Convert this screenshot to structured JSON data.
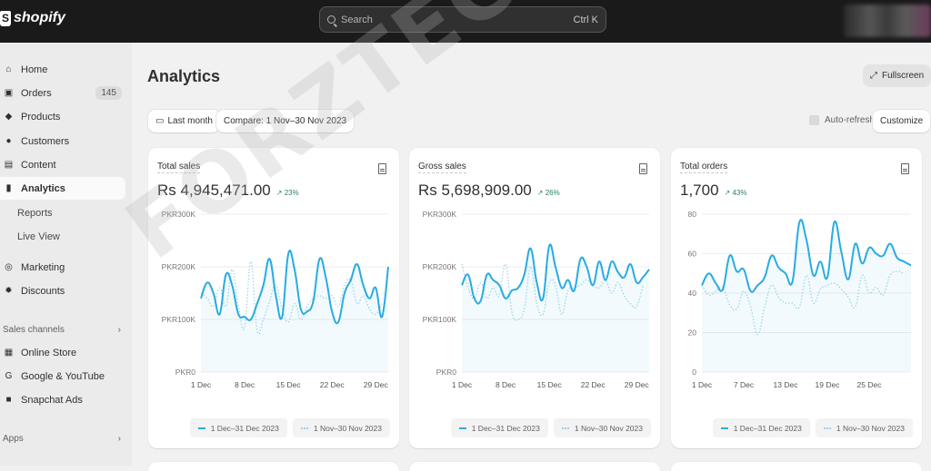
{
  "topbar": {
    "brand": "shopify",
    "search_placeholder": "Search",
    "search_shortcut": "Ctrl K"
  },
  "sidebar": {
    "items": [
      {
        "label": "Home",
        "icon": "home-icon"
      },
      {
        "label": "Orders",
        "icon": "inbox-icon",
        "badge": "145"
      },
      {
        "label": "Products",
        "icon": "tag-icon"
      },
      {
        "label": "Customers",
        "icon": "person-icon"
      },
      {
        "label": "Content",
        "icon": "image-icon"
      },
      {
        "label": "Analytics",
        "icon": "bar-chart-icon",
        "active": true
      },
      {
        "label": "Reports",
        "sub": true
      },
      {
        "label": "Live View",
        "sub": true
      },
      {
        "label": "Marketing",
        "icon": "target-icon"
      },
      {
        "label": "Discounts",
        "icon": "discount-icon"
      }
    ],
    "sales_channels_label": "Sales channels",
    "channels": [
      {
        "label": "Online Store",
        "icon": "store-icon"
      },
      {
        "label": "Google & YouTube",
        "icon": "google-icon"
      },
      {
        "label": "Snapchat Ads",
        "icon": "snapchat-icon"
      }
    ],
    "apps_label": "Apps"
  },
  "main": {
    "title": "Analytics",
    "date_button": "Last month",
    "compare_button": "Compare: 1 Nov–30 Nov 2023",
    "fullscreen_button": "Fullscreen",
    "auto_refresh_label": "Auto-refresh",
    "customize_button": "Customize"
  },
  "watermark": "FORZTECH MEDIA",
  "colors": {
    "current_series": "#29abe2",
    "previous_series": "#9dd3e8",
    "delta_positive": "#29845a"
  },
  "chart_data": [
    {
      "type": "line",
      "title": "Total sales",
      "value": "Rs 4,945,471.00",
      "delta": "23%",
      "y_ticks": [
        "PKR300K",
        "PKR200K",
        "PKR100K",
        "PKR0"
      ],
      "ylim": [
        0,
        300000
      ],
      "x_ticks": [
        "1 Dec",
        "8 Dec",
        "15 Dec",
        "22 Dec",
        "29 Dec"
      ],
      "x_tick_days": [
        1,
        8,
        15,
        22,
        29
      ],
      "days": 31,
      "legend": [
        "1 Dec–31 Dec 2023",
        "1 Nov–30 Nov 2023"
      ],
      "series": [
        {
          "name": "1 Dec–31 Dec 2023",
          "values": [
            140000,
            170000,
            150000,
            110000,
            185000,
            165000,
            110000,
            105000,
            100000,
            130000,
            165000,
            215000,
            145000,
            105000,
            225000,
            195000,
            120000,
            115000,
            135000,
            215000,
            180000,
            115000,
            95000,
            150000,
            175000,
            205000,
            165000,
            140000,
            160000,
            105000,
            200000
          ]
        },
        {
          "name": "1 Nov–30 Nov 2023",
          "values": [
            150000,
            140000,
            125000,
            160000,
            125000,
            195000,
            125000,
            85000,
            210000,
            80000,
            100000,
            135000,
            165000,
            120000,
            95000,
            130000,
            100000,
            125000,
            140000,
            145000,
            140000,
            145000,
            125000,
            165000,
            175000,
            130000,
            145000,
            120000,
            110000,
            130000
          ]
        }
      ]
    },
    {
      "type": "line",
      "title": "Gross sales",
      "value": "Rs 5,698,909.00",
      "delta": "26%",
      "y_ticks": [
        "PKR300K",
        "PKR200K",
        "PKR100K",
        "PKR0"
      ],
      "ylim": [
        0,
        300000
      ],
      "x_ticks": [
        "1 Dec",
        "8 Dec",
        "15 Dec",
        "22 Dec",
        "29 Dec"
      ],
      "x_tick_days": [
        1,
        8,
        15,
        22,
        29
      ],
      "days": 31,
      "legend": [
        "1 Dec–31 Dec 2023",
        "1 Nov–30 Nov 2023"
      ],
      "series": [
        {
          "name": "1 Dec–31 Dec 2023",
          "values": [
            165000,
            185000,
            140000,
            135000,
            185000,
            175000,
            165000,
            140000,
            155000,
            160000,
            185000,
            235000,
            170000,
            140000,
            240000,
            200000,
            160000,
            175000,
            155000,
            215000,
            200000,
            165000,
            210000,
            175000,
            210000,
            190000,
            180000,
            205000,
            170000,
            180000,
            195000
          ]
        },
        {
          "name": "1 Nov–30 Nov 2023",
          "values": [
            205000,
            160000,
            140000,
            170000,
            140000,
            160000,
            145000,
            205000,
            115000,
            100000,
            120000,
            200000,
            130000,
            110000,
            170000,
            165000,
            110000,
            155000,
            160000,
            165000,
            175000,
            165000,
            160000,
            175000,
            150000,
            170000,
            145000,
            130000,
            125000,
            165000
          ]
        }
      ]
    },
    {
      "type": "line",
      "title": "Total orders",
      "value": "1,700",
      "delta": "43%",
      "y_ticks": [
        "80",
        "60",
        "40",
        "20",
        "0"
      ],
      "ylim": [
        0,
        80
      ],
      "x_ticks": [
        "1 Dec",
        "7 Dec",
        "13 Dec",
        "19 Dec",
        "25 Dec"
      ],
      "x_tick_days": [
        1,
        7,
        13,
        19,
        25
      ],
      "days": 31,
      "legend": [
        "1 Dec–31 Dec 2023",
        "1 Nov–30 Nov 2023"
      ],
      "series": [
        {
          "name": "1 Dec–31 Dec 2023",
          "values": [
            44,
            50,
            45,
            42,
            59,
            51,
            52,
            41,
            44,
            48,
            59,
            53,
            50,
            46,
            76,
            67,
            49,
            56,
            48,
            76,
            61,
            47,
            65,
            55,
            63,
            60,
            59,
            65,
            58,
            56,
            54
          ]
        },
        {
          "name": "1 Nov–30 Nov 2023",
          "values": [
            44,
            39,
            41,
            43,
            34,
            32,
            41,
            33,
            19,
            33,
            44,
            38,
            35,
            35,
            33,
            49,
            35,
            42,
            44,
            45,
            42,
            38,
            33,
            49,
            40,
            43,
            39,
            49,
            51,
            50
          ]
        }
      ]
    }
  ]
}
